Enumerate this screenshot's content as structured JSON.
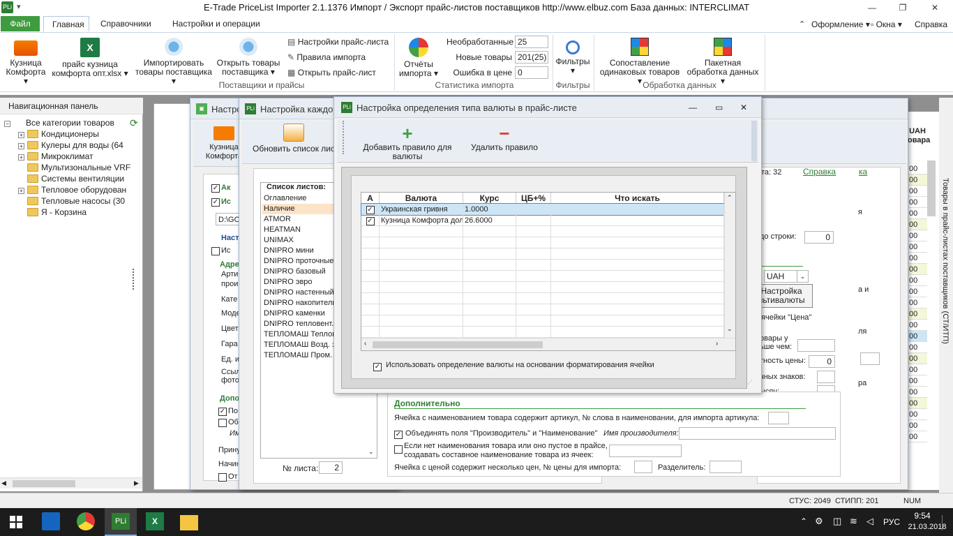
{
  "window": {
    "title": "E-Trade PriceList Importer 2.1.1376     Импорт / Экспорт прайс-листов поставщиков     http://www.elbuz.com     База данных: INTERCLIMAT",
    "logo": "PLi"
  },
  "menu": {
    "file": "Файл",
    "tabs": [
      "Главная",
      "Справочники",
      "Настройки и операции"
    ],
    "right": [
      "Оформление",
      "Окна",
      "Справка"
    ]
  },
  "ribbon": {
    "btn_kuznica": [
      "Кузница",
      "Комфорта"
    ],
    "btn_price": [
      "прайс кузница",
      "комфорта опт.xlsx"
    ],
    "btn_import": [
      "Импортировать",
      "товары поставщика"
    ],
    "btn_open": [
      "Открыть товары",
      "поставщика"
    ],
    "small": [
      "Настройки прайс-листа",
      "Правила импорта",
      "Открыть прайс-лист"
    ],
    "group_suppliers": "Поставщики и прайсы",
    "btn_reports": [
      "Отчёты",
      "импорта"
    ],
    "stats": [
      {
        "label": "Необработанные",
        "value": "25"
      },
      {
        "label": "Новые товары",
        "value": "201(25)"
      },
      {
        "label": "Ошибка в цене",
        "value": "0"
      }
    ],
    "group_stats": "Статистика импорта",
    "btn_filters": "Фильтры",
    "group_filters": "Фильтры",
    "btn_compare": [
      "Сопоставление",
      "одинаковых товаров"
    ],
    "btn_batch": [
      "Пакетная",
      "обработка данных"
    ],
    "group_data": "Обработка данных"
  },
  "nav": {
    "header": "Навигационная панель",
    "root": "Все категории товаров",
    "items": [
      {
        "label": "Кондиционеры",
        "expand": true
      },
      {
        "label": "Кулеры для воды (64",
        "expand": true
      },
      {
        "label": "Микроклимат",
        "expand": true
      },
      {
        "label": "Мультизональные VRF",
        "expand": false
      },
      {
        "label": "Системы вентиляции",
        "expand": false
      },
      {
        "label": "Тепловое оборудован",
        "expand": true
      },
      {
        "label": "Тепловые насосы (30",
        "expand": false
      },
      {
        "label": "Я - Корзина",
        "expand": false
      }
    ]
  },
  "win1": {
    "title": "Настро",
    "btn": [
      "Кузница",
      "Комфорта"
    ],
    "labels": [
      "Ак",
      "Ис",
      "D:\\GO",
      "Наст",
      "Ис",
      "Адре",
      "Арти",
      "прои",
      "Кате",
      "Моде",
      "Цвет",
      "Гара",
      "Ед. и",
      "Ссыл",
      "фото",
      "Допо",
      "По",
      "Об",
      "Им",
      "Прину",
      "Начин",
      "От"
    ]
  },
  "win2": {
    "title": "Настройка каждого",
    "refresh": "Обновить список лис",
    "sheets_title": "Список листов:",
    "sheets": [
      "Оглавление",
      "Наличие",
      "ATMOR",
      "HEATMAN",
      "UNIMAX",
      "DNIPRO мини",
      "DNIPRO проточные",
      "DNIPRO базовый",
      "DNIPRO эвро",
      "DNIPRO настенный",
      "DNIPRO накопители",
      "DNIPRO каменки",
      "DNIPRO тепловент.",
      "ТЕПЛОМАШ Теплове",
      "ТЕПЛОМАШ Возд. за",
      "ТЕПЛОМАШ Пром. за"
    ],
    "sheet_no_label": "№ листа:",
    "sheet_no": "2",
    "right_frag": {
      "count": "та: 32",
      "help": "Справка",
      "help2": "ка",
      "to_row": "до строки:",
      "to_row_val": "0",
      "currency": "UAH",
      "multi": [
        "Настройка",
        "льтивалюты"
      ],
      "price_cell": "з ячейки \"Цена\"",
      "goods1": "овары у",
      "goods2": "ьше чем:",
      "precision": "тность цены:",
      "precision_val": "0",
      "decimals": "чных знаков:",
      "thousands": "ысяч:",
      "extra_title": "Дополнительно",
      "article_row": "Ячейка с наименованием товара содержит артикул, № слова в наименовании, для импорта артикула:",
      "merge_label": "Объединять поля \"Производитель\" и \"Наименование\"",
      "maker_label": "Имя производителя:",
      "empty_name": "Если нет наименования товара или оно пустое в прайсе,",
      "empty_name2": "создавать составное наименование товара из ячеек:",
      "multi_price": "Ячейка с ценой содержит несколько цен, № цены для импорта:",
      "separator": "Разделитель:",
      "frag_ya": "я",
      "frag_ai": "а и",
      "frag_lya": "ля",
      "frag_ra": "ра"
    }
  },
  "win3": {
    "title": "Настройка определения типа валюты в прайс-листе",
    "add": "Добавить правило для валюты",
    "remove": "Удалить правило",
    "columns": [
      "A",
      "Валюта",
      "Курс",
      "ЦБ+%",
      "Что искать"
    ],
    "rows": [
      {
        "checked": true,
        "currency": "Украинская гривня",
        "rate": "1.0000",
        "cb": "",
        "search": ""
      },
      {
        "checked": true,
        "currency": "Кузница Комфорта дол",
        "rate": "26.6000",
        "cb": "",
        "search": ""
      }
    ],
    "use_format": "Использовать определение валюты на основании форматирования ячейки"
  },
  "right_panel": {
    "col": "UAH",
    "col2": "овара",
    "values": [
      "00",
      "00",
      "00",
      "00",
      "00",
      "00",
      "00",
      "00",
      "00",
      "00",
      "00",
      "00",
      "00",
      "00",
      "00",
      "00",
      "00",
      "00",
      "00",
      "00",
      "00",
      "00",
      "00",
      "00",
      "00"
    ],
    "vertical": "Товары в прайс-листах поставщиков (СТ/ИТП)"
  },
  "status": {
    "stus": "СТУС: 2049",
    "stipp": "СТИПП: 201",
    "num": "NUM"
  },
  "taskbar": {
    "lang": "РУС",
    "time": "9:54",
    "date": "21.03.2018"
  },
  "colors": {
    "accent": "#3f9b3f",
    "selection": "#cde6f7",
    "highlight": "#fde3c8"
  }
}
